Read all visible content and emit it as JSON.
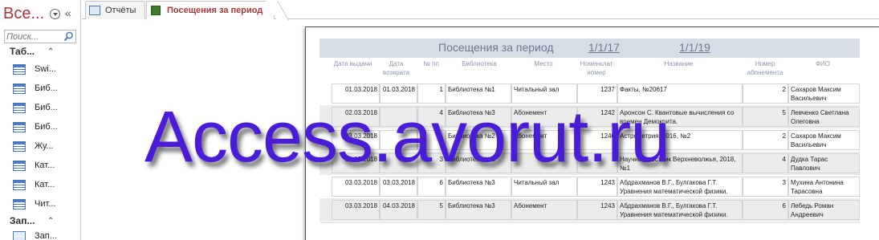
{
  "nav": {
    "title": "Все...",
    "search_placeholder": "Поиск...",
    "group_tables": "Таб...",
    "group_queries": "Зап...",
    "items": [
      {
        "label": "Swi..."
      },
      {
        "label": "Биб..."
      },
      {
        "label": "Биб..."
      },
      {
        "label": "Биб..."
      },
      {
        "label": "Жу..."
      },
      {
        "label": "Кат..."
      },
      {
        "label": "Кат..."
      },
      {
        "label": "Чит..."
      }
    ],
    "query_item": {
      "label": "Зап..."
    }
  },
  "tabs": [
    {
      "label": "Отчёты",
      "icon": "report-list-icon"
    },
    {
      "label": "Посещения за период",
      "icon": "report-icon",
      "active": true
    }
  ],
  "report": {
    "title": "Посещения за период",
    "date_from": "1/1/17",
    "date_to": "1/1/19",
    "columns": [
      {
        "label": "Дата выдачи"
      },
      {
        "label": "Дата возврата"
      },
      {
        "label": "№ пп"
      },
      {
        "label": "Библиотека"
      },
      {
        "label": "Место"
      },
      {
        "label": "Номенклат номер"
      },
      {
        "label": "Название"
      },
      {
        "label": "Номер абонемента"
      },
      {
        "label": "ФИО"
      }
    ],
    "rows": [
      {
        "issue": "01.03.2018",
        "return": "01.03.2018",
        "num": "1",
        "library": "Библиотека №1",
        "place": "Читальный зал",
        "code": "1237",
        "title": "Факты, №20617",
        "ticket": "2",
        "name": "Сахаров Максим Васильевич"
      },
      {
        "issue": "02.03.2018",
        "return": "",
        "num": "4",
        "library": "Библиотека №3",
        "place": "Абонемент",
        "code": "1242",
        "title": "Аронсон С. Квантовые вычисления со времен Демокрита.",
        "ticket": "5",
        "name": "Левченко Светлана Олеговна"
      },
      {
        "issue": "03.03.2018",
        "return": "",
        "num": "",
        "library": "Библиотека №2",
        "place": "Абонемент",
        "code": "1240",
        "title": "Астрометрия, 2016, №2",
        "ticket": "2",
        "name": "Сахаров Максим Васильевич"
      },
      {
        "issue": "03.03.2018",
        "return": "",
        "num": "3",
        "library": "Библиотека №2",
        "place": "",
        "code": "",
        "title": "Научный вестник Верхневолжья, 2018, №1",
        "ticket": "4",
        "name": "Дудка Тарас Павлович"
      },
      {
        "issue": "03.03.2018",
        "return": "03.03.2018",
        "num": "6",
        "library": "Библиотека №3",
        "place": "Читальный зал",
        "code": "1243",
        "title": "Абдрахманов В.Г., Булгакова Г.Т. Уравнения математической физики.",
        "ticket": "3",
        "name": "Мухина Антонина Тарасовна"
      },
      {
        "issue": "03.03.2018",
        "return": "04.03.2018",
        "num": "5",
        "library": "Библиотека №3",
        "place": "Абонемент",
        "code": "1243",
        "title": "Абдрахманов В.Г., Булгакова Г.Т. Уравнения математической физики.",
        "ticket": "6",
        "name": "Лебедь Роман Андреевич"
      }
    ]
  },
  "watermark": "Access.avorut.ru"
}
